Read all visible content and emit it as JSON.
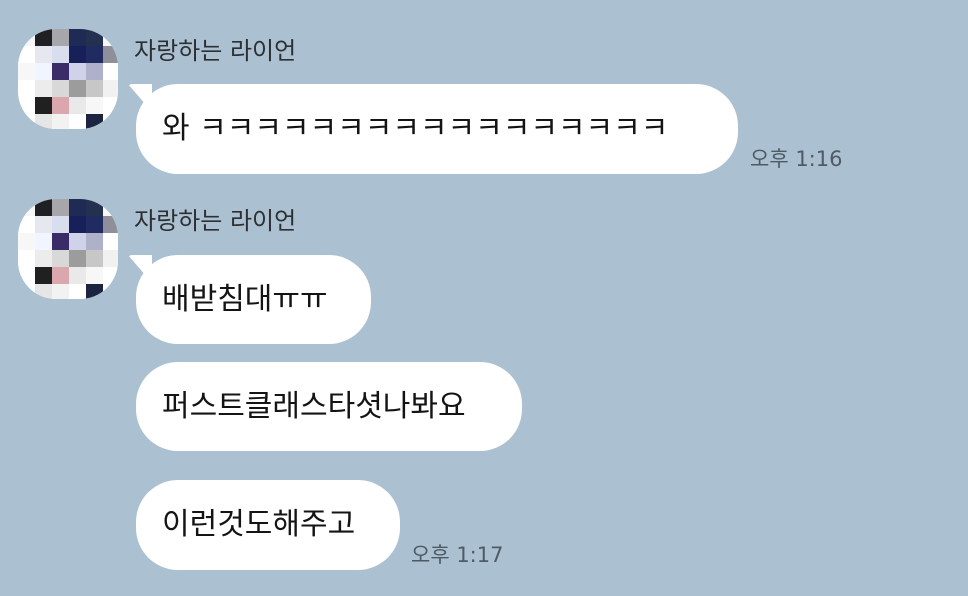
{
  "chat": {
    "messages": [
      {
        "sender": "자랑하는 라이언",
        "text": "와 ㅋㅋㅋㅋㅋㅋㅋㅋㅋㅋㅋㅋㅋㅋㅋㅋㅋ",
        "time": "오후 1:16"
      },
      {
        "sender": "자랑하는 라이언",
        "text": "배받침대ㅠㅠ"
      },
      {
        "text": "퍼스트클래스타셧나봐요"
      },
      {
        "text": "이런것도해주고",
        "time": "오후 1:17"
      }
    ]
  },
  "colors": {
    "background": "#abc1d1",
    "bubble": "#ffffff",
    "sender_text": "#2d2f33",
    "message_text": "#141414",
    "time_text": "#4e5b66"
  },
  "icons": {
    "avatar": "pixelated-profile-avatar"
  }
}
